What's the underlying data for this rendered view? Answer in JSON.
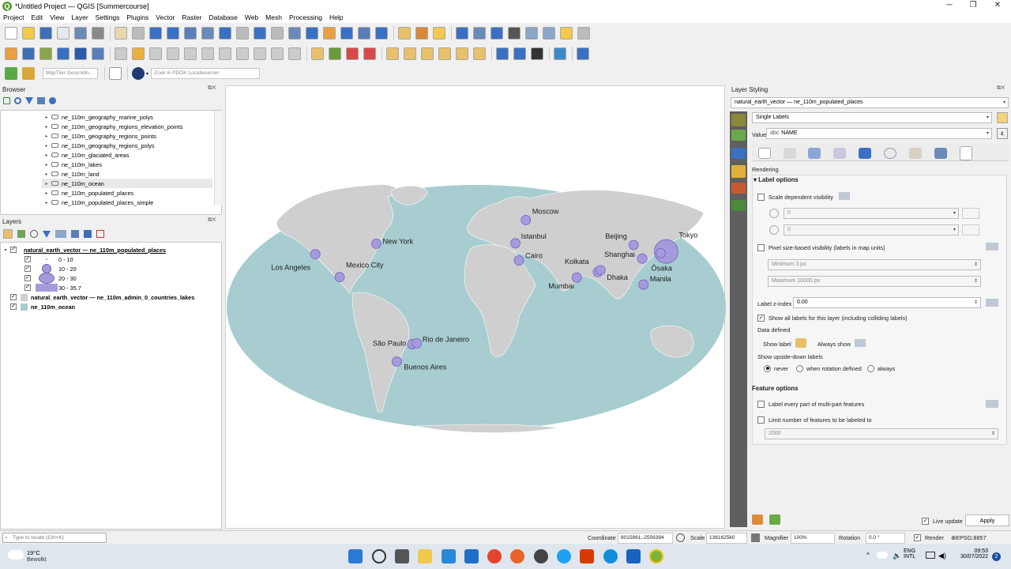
{
  "window": {
    "title": "*Untitled Project — QGIS [Summercourse]",
    "app_badge": "Q"
  },
  "menu": [
    "Project",
    "Edit",
    "View",
    "Layer",
    "Settings",
    "Plugins",
    "Vector",
    "Raster",
    "Database",
    "Web",
    "Mesh",
    "Processing",
    "Help"
  ],
  "toolbar3": {
    "geocoder_placeholder": "MapTiler Geocodin...",
    "locator_placeholder": "Zoek in PDOK Locatieserver"
  },
  "browser": {
    "title": "Browser",
    "items": [
      "ne_110m_geography_marine_polys",
      "ne_110m_geography_regions_elevation_points",
      "ne_110m_geography_regions_points",
      "ne_110m_geography_regions_polys",
      "ne_110m_glaciated_areas",
      "ne_110m_lakes",
      "ne_110m_land",
      "ne_110m_ocean",
      "ne_110m_populated_places",
      "ne_110m_populated_places_simple"
    ]
  },
  "layers": {
    "title": "Layers",
    "l1": "natural_earth_vector — ne_110m_populated_places",
    "classes": [
      "0 - 10",
      "10 - 20",
      "20 - 30",
      "30 - 35.7"
    ],
    "l2": "natural_earth_vector — ne_110m_admin_0_countries_lakes",
    "l3": "ne_110m_ocean"
  },
  "map": {
    "cities": [
      {
        "name": "Moscow",
        "lon": 37.6,
        "lat": 55.8,
        "size": 1
      },
      {
        "name": "Istanbul",
        "lon": 29,
        "lat": 41,
        "size": 1
      },
      {
        "name": "Cairo",
        "lon": 31.2,
        "lat": 30,
        "size": 1
      },
      {
        "name": "Beijing",
        "lon": 116.4,
        "lat": 39.9,
        "size": 1
      },
      {
        "name": "Tokyo",
        "lon": 139.7,
        "lat": 35.7,
        "size": 3
      },
      {
        "name": "Ōsaka",
        "lon": 135.5,
        "lat": 34.7,
        "size": 1
      },
      {
        "name": "Shanghai",
        "lon": 121.5,
        "lat": 31.2,
        "size": 1
      },
      {
        "name": "Kolkata",
        "lon": 88.4,
        "lat": 22.6,
        "size": 1
      },
      {
        "name": "Dhaka",
        "lon": 90.4,
        "lat": 23.8,
        "size": 1
      },
      {
        "name": "Mumbai",
        "lon": 72.9,
        "lat": 19.1,
        "size": 1
      },
      {
        "name": "Manila",
        "lon": 121,
        "lat": 14.6,
        "size": 1
      },
      {
        "name": "New York",
        "lon": -74,
        "lat": 40.7,
        "size": 1
      },
      {
        "name": "Los Angeles",
        "lon": -118.2,
        "lat": 34,
        "size": 1
      },
      {
        "name": "Mexico City",
        "lon": -99.1,
        "lat": 19.4,
        "size": 1
      },
      {
        "name": "São Paulo",
        "lon": -46.6,
        "lat": -23.5,
        "size": 1
      },
      {
        "name": "Rio de Janeiro",
        "lon": -43.2,
        "lat": -22.9,
        "size": 1
      },
      {
        "name": "Buenos Aires",
        "lon": -58.4,
        "lat": -34.6,
        "size": 1
      }
    ]
  },
  "styling": {
    "title": "Layer Styling",
    "layer_select": "natural_earth_vector — ne_110m_populated_places",
    "mode": "Single Labels",
    "value_label": "Value",
    "value_field": "NAME",
    "value_prefix": "abc",
    "section": "Rendering",
    "label_options": "Label options",
    "scale_dep": "Scale dependent visibility",
    "min_scale": "0",
    "max_scale": "0",
    "pixel_size": "Pixel size-based visibility (labels in map units)",
    "min_px": "Minimum 3 px",
    "max_px": "Maximum 10000 px",
    "zindex_label": "Label z-index",
    "zindex": "0.00",
    "show_all": "Show all labels for this layer (including colliding labels)",
    "data_defined": "Data defined",
    "show_label": "Show label",
    "always_show": "Always show",
    "upside": "Show upside-down labels",
    "radio": [
      "never",
      "when rotation defined",
      "always"
    ],
    "feature_options": "Feature options",
    "multipart": "Label every part of multi-part features",
    "limit": "Limit number of features to be labeled to",
    "limit_val": "2000",
    "live": "Live update",
    "apply": "Apply"
  },
  "status": {
    "locate": "Type to locate (Ctrl+K)",
    "coord_label": "Coordinate",
    "coord": "8015861,-2556394",
    "scale_label": "Scale",
    "scale": "136162560",
    "magnifier_label": "Magnifier",
    "magnifier": "100%",
    "rotation_label": "Rotation",
    "rotation": "0.0 °",
    "render": "Render",
    "crs": "EPSG:8857"
  },
  "taskbar": {
    "temp": "19°C",
    "weather": "Bewolkt",
    "lang1": "ENG",
    "lang2": "INTL",
    "time": "09:53",
    "date": "30/07/2022",
    "badge": "2"
  },
  "colors": {
    "ocean": "#a7cdd0",
    "land": "#cfcfcf",
    "symbol": "#a59bdc",
    "symbol_stroke": "#6f63c0",
    "accent": "#3a70c4"
  }
}
